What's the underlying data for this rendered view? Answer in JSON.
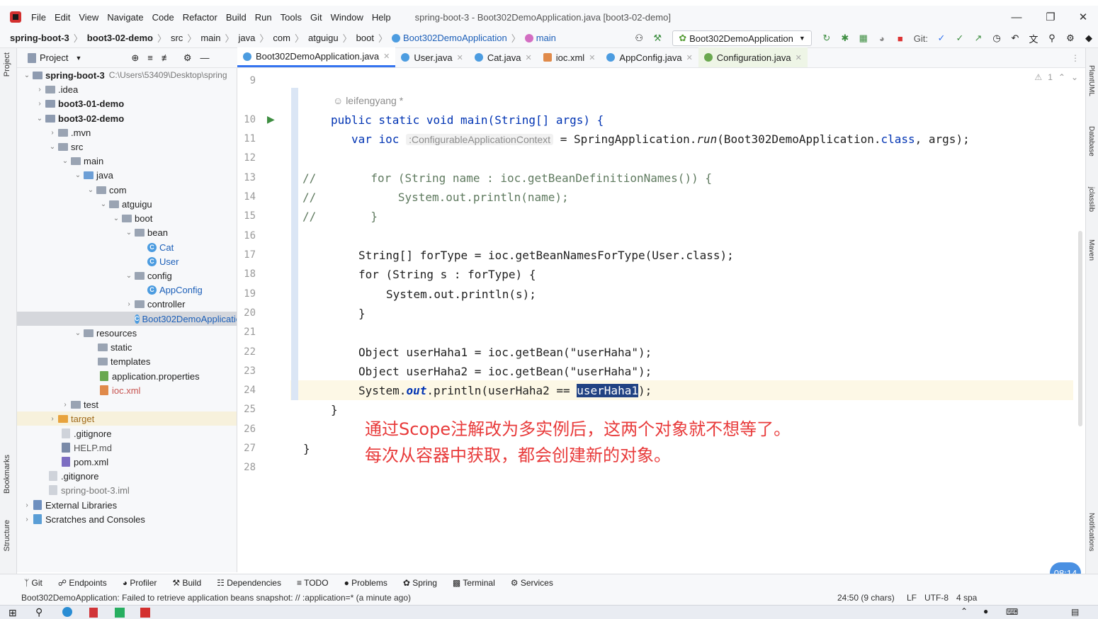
{
  "menubar": {
    "items": [
      "File",
      "Edit",
      "View",
      "Navigate",
      "Code",
      "Refactor",
      "Build",
      "Run",
      "Tools",
      "Git",
      "Window",
      "Help"
    ],
    "title": "spring-boot-3 - Boot302DemoApplication.java [boot3-02-demo]"
  },
  "breadcrumb": [
    "spring-boot-3",
    "boot3-02-demo",
    "src",
    "main",
    "java",
    "com",
    "atguigu",
    "boot",
    "Boot302DemoApplication",
    "main"
  ],
  "toolbar": {
    "run_config": "Boot302DemoApplication",
    "git_label": "Git:"
  },
  "project_panel": {
    "title": "Project"
  },
  "tree": [
    {
      "label": "spring-boot-3",
      "extra": "C:\\Users\\53409\\Desktop\\spring",
      "bold": true
    },
    {
      "label": ".idea"
    },
    {
      "label": "boot3-01-demo",
      "bold": true
    },
    {
      "label": "boot3-02-demo",
      "bold": true
    },
    {
      "label": ".mvn"
    },
    {
      "label": "src"
    },
    {
      "label": "main"
    },
    {
      "label": "java"
    },
    {
      "label": "com"
    },
    {
      "label": "atguigu"
    },
    {
      "label": "boot"
    },
    {
      "label": "bean"
    },
    {
      "label": "Cat"
    },
    {
      "label": "User"
    },
    {
      "label": "config"
    },
    {
      "label": "AppConfig"
    },
    {
      "label": "controller"
    },
    {
      "label": "Boot302DemoApplication"
    },
    {
      "label": "resources"
    },
    {
      "label": "static"
    },
    {
      "label": "templates"
    },
    {
      "label": "application.properties"
    },
    {
      "label": "ioc.xml"
    },
    {
      "label": "test"
    },
    {
      "label": "target"
    },
    {
      "label": ".gitignore"
    },
    {
      "label": "HELP.md"
    },
    {
      "label": "pom.xml"
    },
    {
      "label": ".gitignore"
    },
    {
      "label": "spring-boot-3.iml"
    },
    {
      "label": "External Libraries"
    },
    {
      "label": "Scratches and Consoles"
    }
  ],
  "tabs": [
    "Boot302DemoApplication.java",
    "User.java",
    "Cat.java",
    "ioc.xml",
    "AppConfig.java",
    "Configuration.java"
  ],
  "editor": {
    "line_numbers": [
      "9",
      "10",
      "11",
      "12",
      "13",
      "14",
      "15",
      "16",
      "17",
      "18",
      "19",
      "20",
      "21",
      "22",
      "23",
      "24",
      "25",
      "26",
      "27",
      "28"
    ],
    "author_hint": "leifengyang *",
    "inlay_hint": ":ConfigurableApplicationContext",
    "warnings": "1",
    "code": {
      "l10": "public static void main(String[] args) {",
      "l11a": "var ioc ",
      "l11b": " = SpringApplication.",
      "l11c": "run",
      "l11d": "(Boot302DemoApplication.",
      "l11e": "class",
      "l11f": ", args);",
      "l13": "//        for (String name : ioc.getBeanDefinitionNames()) {",
      "l14": "//            System.out.println(name);",
      "l15": "//        }",
      "l17": "String[] forType = ioc.getBeanNamesForType(User.class);",
      "l18": "for (String s : forType) {",
      "l19": "System.out.println(s);",
      "l20": "}",
      "l22": "Object userHaha1 = ioc.getBean(\"userHaha\");",
      "l23": "Object userHaha2 = ioc.getBean(\"userHaha\");",
      "l24a": "System.",
      "l24b": "out",
      "l24c": ".println(userHaha2 == ",
      "l24d": "userHaha1",
      "l24e": ");",
      "l25": "}",
      "l27": "}"
    }
  },
  "annotation": {
    "line1": "通过Scope注解改为多实例后，这两个对象就不想等了。",
    "line2": "每次从容器中获取，都会创建新的对象。"
  },
  "right_tools": [
    "PlantUML",
    "Database",
    "jclasslib",
    "Maven",
    "Notifications"
  ],
  "left_tools": [
    "Project",
    "Bookmarks",
    "Structure"
  ],
  "bottom_tools": [
    "Git",
    "Endpoints",
    "Profiler",
    "Build",
    "Dependencies",
    "TODO",
    "Problems",
    "Spring",
    "Terminal",
    "Services"
  ],
  "status": {
    "message": "Boot302DemoApplication: Failed to retrieve application beans snapshot: // :application=* (a minute ago)",
    "position": "24:50 (9 chars)",
    "line_sep": "LF",
    "encoding": "UTF-8",
    "indent": "4 spa"
  },
  "time_badge": "08:14",
  "colors": {
    "accent": "#3574f0",
    "annotation": "#e83a3a",
    "keyword": "#0033b3",
    "string": "#067d17"
  }
}
